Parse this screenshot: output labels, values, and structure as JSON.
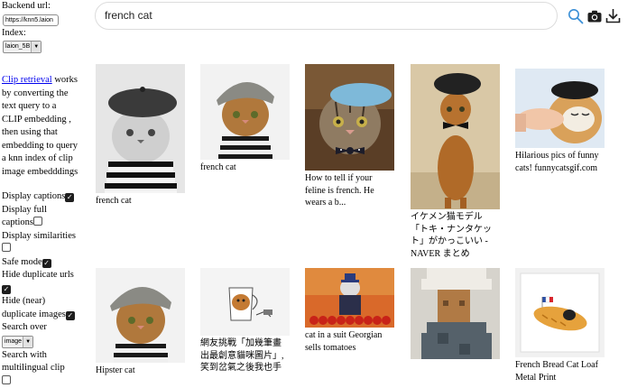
{
  "sidebar": {
    "backend_label": "Backend url:",
    "backend_value": "https://knn5.laion",
    "index_label": "Index:",
    "index_value": "laion_5B",
    "description_link": "Clip retrieval",
    "description_lines": [
      " works",
      "by converting the",
      "text query to a",
      "CLIP embedding ,",
      "then using that",
      "embedding to query",
      "a knn index of clip",
      "image embedddings"
    ],
    "options": {
      "display_captions": "Display captions",
      "display_full_captions_1": "Display full",
      "display_full_captions_2": "captions",
      "display_similarities": "Display similarities",
      "safe_mode": "Safe mode",
      "hide_duplicate_urls": "Hide duplicate urls",
      "hide_near_duplicates_1": "Hide (near)",
      "hide_near_duplicates_2": "duplicate images",
      "search_over": "Search over",
      "search_over_value": "image",
      "multilingual_1": "Search with",
      "multilingual_2": "multilingual clip"
    }
  },
  "search": {
    "query": "french cat"
  },
  "icons": [
    "search-icon",
    "camera-icon",
    "download-icon"
  ],
  "results": [
    {
      "caption": [
        "french cat"
      ]
    },
    {
      "caption": [
        "french cat"
      ]
    },
    {
      "caption": [
        "How to tell if your",
        "feline is french. He",
        "wears a b..."
      ]
    },
    {
      "caption": [
        "イケメン猫モデル",
        "「トキ・ナンタケッ",
        "ト」がかっこいい -",
        "NAVER まとめ"
      ]
    },
    {
      "caption": [
        "Hilarious pics of funny",
        "cats! funnycatsgif.com"
      ]
    },
    {
      "caption": [
        "Hipster cat"
      ]
    },
    {
      "caption": [
        "網友挑戰「加幾筆畫",
        "出最創意貓咪圖片」,",
        "笑到岔氣之後我也手"
      ]
    },
    {
      "caption": [
        "cat in a suit Georgian",
        "sells tomatoes"
      ]
    },
    {
      "caption": []
    },
    {
      "caption": [
        "French Bread Cat Loaf",
        "Metal Print"
      ]
    }
  ]
}
